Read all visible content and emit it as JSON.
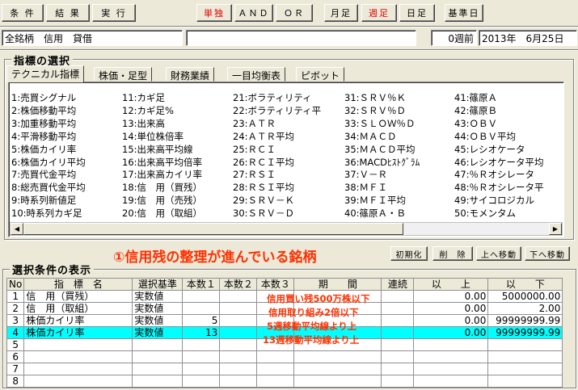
{
  "toolbar": {
    "buttons": [
      "条 件",
      "結 果",
      "実 行"
    ],
    "mode_buttons": [
      "単独",
      "ＡＮＤ",
      "ＯＲ"
    ],
    "period_buttons": [
      "月足",
      "週足",
      "日足"
    ],
    "base_date_label": "基準日"
  },
  "info": {
    "scope": "全銘柄　信用　貸借",
    "blank": "",
    "weeks_ago": "0週前",
    "date": "2013年　6月25日"
  },
  "indicator_section": {
    "title": "指標の選択",
    "tabs": [
      "テクニカル指標",
      "株価・足型",
      "財務業績",
      "一目均衡表",
      "ピボット"
    ],
    "columns": [
      [
        "1:売買シグナル",
        "2:株価移動平均",
        "3:加重移動平均",
        "4:平滑移動平均",
        "5:株価カイリ率",
        "6:株価カイリ平均",
        "7:売買代金平均",
        "8:総売買代金平均",
        "9:時系列新値足",
        "10:時系列カギ足"
      ],
      [
        "11:カギ足",
        "12:カギ足%",
        "13:出来高",
        "14:単位株倍率",
        "15:出来高平均線",
        "16:出来高平均倍率",
        "17:出来高カイリ率",
        "18:信　用（買残）",
        "19:信　用（売残）",
        "20:信　用（取組）"
      ],
      [
        "21:ボラティリティ",
        "22:ボラティリティ平",
        "23:ＡＴＲ",
        "24:ＡＴＲ平均",
        "25:ＲＣＩ",
        "26:ＲＣＩ平均",
        "27:ＲＳＩ",
        "28:ＲＳＩ平均",
        "29:ＳＲＶ－Ｋ",
        "30:ＳＲＶ－Ｄ"
      ],
      [
        "31:ＳＲＶ％Ｋ",
        "32:ＳＲＶ％Ｄ",
        "33:ＳＬＯＷ％Ｄ",
        "34:ＭＡＣＤ",
        "35:ＭＡＣＤ平均",
        "36:MACDﾋｽﾄｸﾞﾗﾑ",
        "37:Ｖ－Ｒ",
        "38:ＭＦＩ",
        "39:ＭＦＩ平均",
        "40:篠原Ａ・Ｂ"
      ],
      [
        "41:篠原Ａ",
        "42:篠原Ｂ",
        "43:ＯＢＶ",
        "44:ＯＢＶ平均",
        "45:レシオケータ",
        "46:レシオケータ平均",
        "47:％Ｒオシレータ",
        "48:％Ｒオシレータ平",
        "49:サイコロジカル",
        "50:モメンタム"
      ]
    ]
  },
  "headline": "①信用残の整理が進んでいる銘柄",
  "actions": [
    "初期化",
    "削　除",
    "上へ移動",
    "下へ移動"
  ],
  "conditions_section": {
    "title": "選択条件の表示",
    "headers": [
      "No",
      "指　標　名",
      "選択基準",
      "本数１",
      "本数２",
      "本数３",
      "期　　間",
      "連続",
      "以　　上",
      "以　　下"
    ],
    "rows": [
      {
        "no": "1",
        "name": "信　用（買残）",
        "basis": "実数値",
        "n1": "",
        "n2": "",
        "n3": "",
        "period": "",
        "cont": "",
        "min": "0.00",
        "max": "5000000.00",
        "note": "信用買い残500万株以下"
      },
      {
        "no": "2",
        "name": "信　用（取組）",
        "basis": "実数値",
        "n1": "",
        "n2": "",
        "n3": "",
        "period": "",
        "cont": "",
        "min": "0.00",
        "max": "2.00",
        "note": "信用取り組み2倍以下"
      },
      {
        "no": "3",
        "name": "株価カイリ率",
        "basis": "実数値",
        "n1": "5",
        "n2": "",
        "n3": "",
        "period": "",
        "cont": "",
        "min": "0.00",
        "max": "99999999.99",
        "note": "5週移動平均線より上"
      },
      {
        "no": "4",
        "name": "株価カイリ率",
        "basis": "実数値",
        "n1": "13",
        "n2": "",
        "n3": "",
        "period": "",
        "cont": "",
        "min": "0.00",
        "max": "99999999.99",
        "note": "13週移動平均線より上"
      },
      {
        "no": "5",
        "name": "",
        "basis": "",
        "n1": "",
        "n2": "",
        "n3": "",
        "period": "",
        "cont": "",
        "min": "",
        "max": "",
        "note": ""
      },
      {
        "no": "6",
        "name": "",
        "basis": "",
        "n1": "",
        "n2": "",
        "n3": "",
        "period": "",
        "cont": "",
        "min": "",
        "max": "",
        "note": ""
      },
      {
        "no": "7",
        "name": "",
        "basis": "",
        "n1": "",
        "n2": "",
        "n3": "",
        "period": "",
        "cont": "",
        "min": "",
        "max": "",
        "note": ""
      },
      {
        "no": "8",
        "name": "",
        "basis": "",
        "n1": "",
        "n2": "",
        "n3": "",
        "period": "",
        "cont": "",
        "min": "",
        "max": "",
        "note": ""
      }
    ],
    "highlight_row": 4
  },
  "colors": {
    "accent_red": "#e00000",
    "annotation": "#ff3000",
    "highlight": "#00ffff"
  },
  "icons": {
    "scroll_left": "triangle-left-icon",
    "scroll_right": "triangle-right-icon"
  }
}
